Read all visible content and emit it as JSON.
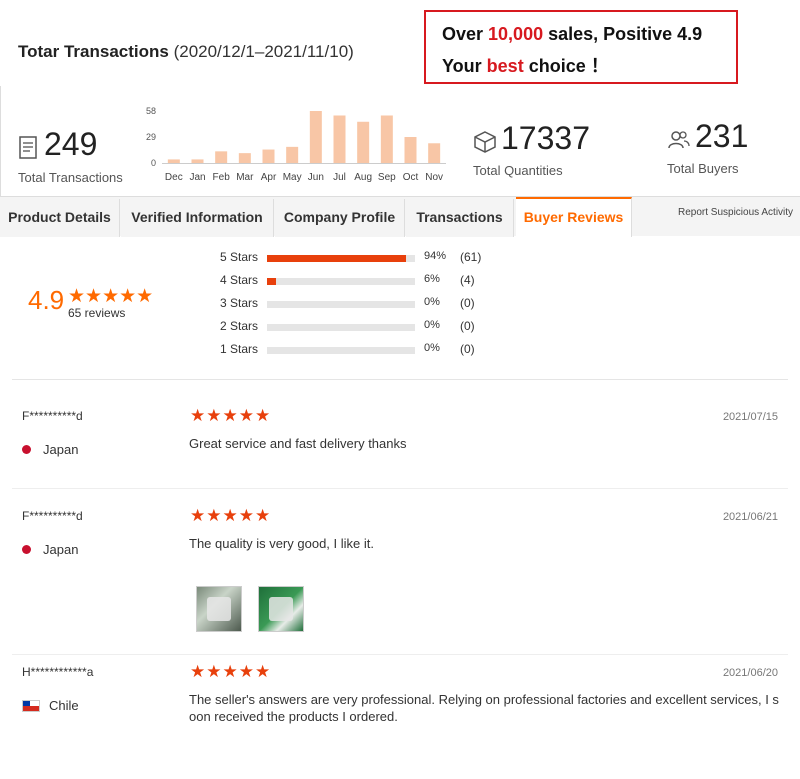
{
  "header": {
    "title": "Totar Transactions",
    "range": "(2020/12/1–2021/11/10)"
  },
  "promo": {
    "line1_pre": "Over ",
    "line1_red": "10,000",
    "line1_post": " sales, Positive 4.9",
    "line2_pre": "Your ",
    "line2_red": "best",
    "line2_post": " choice ！"
  },
  "stats": {
    "transactions": {
      "value": "249",
      "label": "Total Transactions",
      "icon": "document-icon"
    },
    "quantities": {
      "value": "17337",
      "label": "Total Quantities",
      "icon": "box-icon"
    },
    "buyers": {
      "value": "231",
      "label": "Total Buyers",
      "icon": "users-icon"
    }
  },
  "chart_data": {
    "type": "bar",
    "categories": [
      "Dec",
      "Jan",
      "Feb",
      "Mar",
      "Apr",
      "May",
      "Jun",
      "Jul",
      "Aug",
      "Sep",
      "Oct",
      "Nov"
    ],
    "values": [
      4,
      4,
      13,
      11,
      15,
      18,
      58,
      53,
      46,
      53,
      29,
      22
    ],
    "yticks": [
      "58",
      "29",
      "0"
    ],
    "ylim": [
      0,
      58
    ],
    "color": "#f8c6a6"
  },
  "tabs": [
    {
      "label": "Product Details",
      "active": false
    },
    {
      "label": "Verified Information",
      "active": false
    },
    {
      "label": "Company Profile",
      "active": false
    },
    {
      "label": "Transactions",
      "active": false
    },
    {
      "label": "Buyer Reviews",
      "active": true
    }
  ],
  "report_link": "Report Suspicious Activity",
  "rating": {
    "score": "4.9",
    "stars": "★★★★★",
    "count_text": "65 reviews",
    "distribution": [
      {
        "label": "5 Stars",
        "fraction": 0.94,
        "pct": "94%",
        "count": "(61)"
      },
      {
        "label": "4 Stars",
        "fraction": 0.06,
        "pct": "6%",
        "count": "(4)"
      },
      {
        "label": "3 Stars",
        "fraction": 0,
        "pct": "0%",
        "count": "(0)"
      },
      {
        "label": "2 Stars",
        "fraction": 0,
        "pct": "0%",
        "count": "(0)"
      },
      {
        "label": "1 Stars",
        "fraction": 0,
        "pct": "0%",
        "count": "(0)"
      }
    ]
  },
  "reviews": [
    {
      "name": "F**********d",
      "country": "Japan",
      "stars": "★★★★★",
      "date": "2021/07/15",
      "text": "Great service and fast delivery thanks"
    },
    {
      "name": "F**********d",
      "country": "Japan",
      "stars": "★★★★★",
      "date": "2021/06/21",
      "text": "The quality is very good, I like it."
    },
    {
      "name": "H************a",
      "country": "Chile",
      "stars": "★★★★★",
      "date": "2021/06/20",
      "text": "The seller's answers are very professional. Relying on professional factories and excellent services, I s oon received the products I ordered."
    }
  ]
}
